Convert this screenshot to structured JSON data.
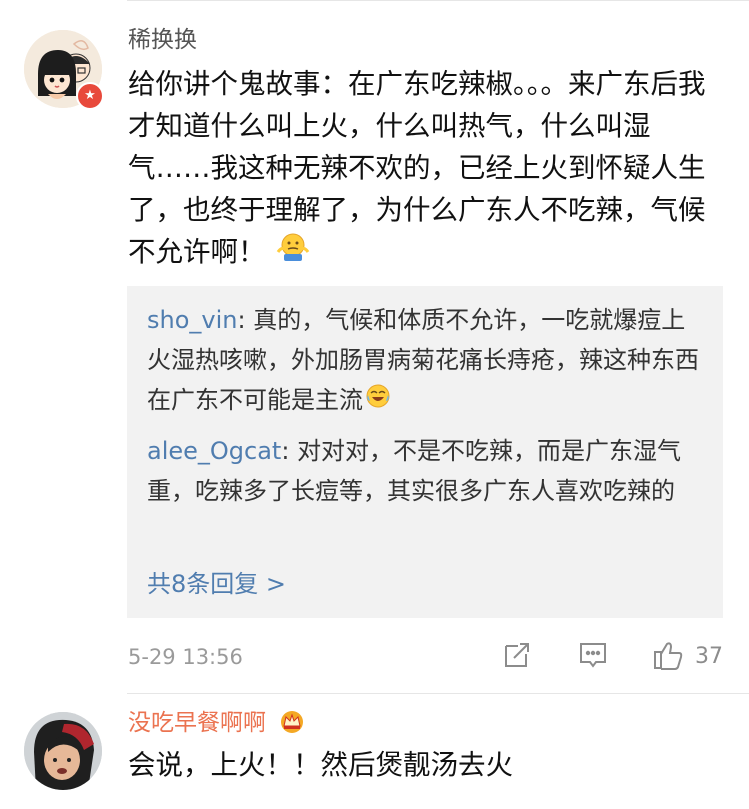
{
  "comment1": {
    "username": "稀换换",
    "text": "给你讲个鬼故事：在广东吃辣椒。。。来广东后我才知道什么叫上火，什么叫热气，什么叫湿气……我这种无辣不欢的，已经上火到怀疑人生了，也终于理解了，为什么广东人不吃辣，气候不允许啊！",
    "trailing_emoji": "shrug-emoji",
    "replies": [
      {
        "user": "sho_vin",
        "sep": ": ",
        "text": "真的，气候和体质不允许，一吃就爆痘上火湿热咳嗽，外加肠胃病菊花痛长痔疮，辣这种东西在广东不可能是主流",
        "emoji": "laugh-cry-emoji"
      },
      {
        "user": "alee_Ogcat",
        "sep": ": ",
        "text": "对对对，不是不吃辣，而是广东湿气重，吃辣多了长痘等，其实很多广东人喜欢吃辣的"
      }
    ],
    "more_replies": "共8条回复 >",
    "time": "5-29 13:56",
    "like_count": "37"
  },
  "comment2": {
    "username": "没吃早餐啊啊",
    "badge_icon": "crown-icon",
    "text": "会说，上火！！然后煲靓汤去火"
  },
  "colors": {
    "link_blue": "#507daf",
    "username_orange": "#eb7350",
    "reply_bg": "#f2f2f2",
    "meta_gray": "#9a9a9a"
  }
}
